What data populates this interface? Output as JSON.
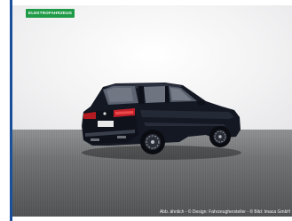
{
  "gallery": {
    "badge_label": "ELEKTROFAHRZEUG",
    "caption": "Abb. ähnlich - © Design: Fahrzeughersteller - © Bild: Imaca GmbH",
    "accent_color": "#1f9b47",
    "sidebar_color": "#1a4f9c",
    "car_color": "#10131c",
    "icons": [
      "car-photo"
    ]
  }
}
